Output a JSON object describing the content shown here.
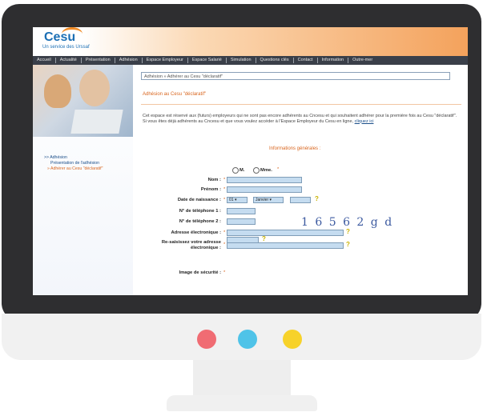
{
  "colors": {
    "accent": "#f08a24",
    "nav_bg": "#3a3f49",
    "link": "#1b4f8a",
    "title": "#d9661f",
    "frame": "#2e2e30"
  },
  "monitor_dots": [
    {
      "color": "#f06c73"
    },
    {
      "color": "#4fc3e8"
    },
    {
      "color": "#f7d22a"
    }
  ],
  "site": {
    "logo": "Cesu",
    "tagline": "Un service des Urssaf"
  },
  "nav": [
    "Accueil",
    "Actualité",
    "Présentation",
    "Adhésion",
    "Espace Employeur",
    "Espace Salarié",
    "Simulation",
    "Questions clés",
    "Contact",
    "Information",
    "Outre-mer"
  ],
  "sidebar": {
    "links": [
      {
        "label": ">> Adhésion"
      },
      {
        "label": "Présentation de l'adhésion"
      },
      {
        "label": "» Adhérer au Cesu \"déclaratif\""
      }
    ]
  },
  "breadcrumb": "Adhésion » Adhérer au Cesu \"déclaratif\"",
  "page_title": "Adhésion au Cesu \"déclaratif\"",
  "intro": {
    "line1": "Cet espace est réservé aux (futurs) employeurs qui ne sont pas encore adhérents au Cncesu et qui souhaitent adhérer pour la première fois au Cesu \"déclaratif\".",
    "line2": "Si vous êtes déjà adhérents au Cncesu et que vous voulez accéder à l'Espace Employeur du Cesu en ligne,",
    "link": "cliquez ici"
  },
  "section_title": "Informations générales :",
  "form": {
    "civility": {
      "m": "M.",
      "mme": "Mme."
    },
    "nom": "Nom :",
    "prenom": "Prénom :",
    "birth": "Date de naissance :",
    "birth_day": "01",
    "birth_month": "Janvier",
    "phone1": "N° de téléphone 1 :",
    "phone2": "N° de téléphone 2 :",
    "email": "Adresse électronique :",
    "email2": "Re-saisissez votre adresse électronique :",
    "captcha_label": "Image de sécurité :",
    "captcha_text": "1 6 5 6 2 g d",
    "required": "*"
  }
}
